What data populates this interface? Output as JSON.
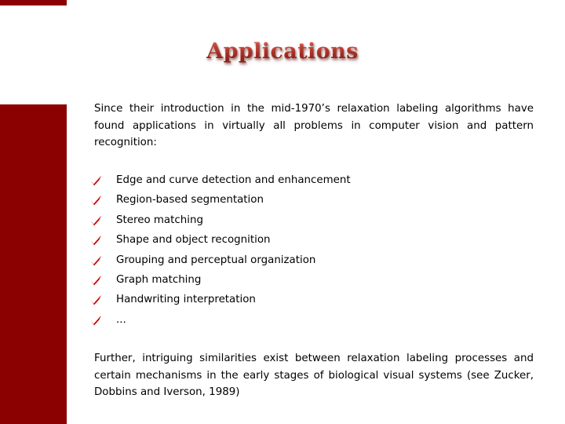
{
  "slide": {
    "title": "Applications",
    "intro_paragraph": "Since their introduction in the mid-1970’s relaxation labeling algorithms have found applications in virtually all problems in computer vision and pattern recognition:",
    "bullets": [
      {
        "icon": "red-check-icon",
        "label": "Edge and curve detection and enhancement"
      },
      {
        "icon": "red-check-icon",
        "label": "Region-based segmentation"
      },
      {
        "icon": "red-check-icon",
        "label": "Stereo matching"
      },
      {
        "icon": "red-check-icon",
        "label": "Shape and object recognition"
      },
      {
        "icon": "red-check-icon",
        "label": "Grouping and perceptual organization"
      },
      {
        "icon": "red-check-icon",
        "label": "Graph matching"
      },
      {
        "icon": "red-check-icon",
        "label": "Handwriting interpretation"
      },
      {
        "icon": "red-check-icon",
        "label": "..."
      }
    ],
    "outro_paragraph": "Further, intriguing similarities exist between relaxation labeling processes and certain mechanisms in the early stages of biological visual systems (see Zucker, Dobbins and Iverson, 1989)",
    "colors": {
      "accent_bar": "#8b0000",
      "title_red": "#c0392b",
      "check_red": "#cc0000",
      "background": "#ffffff",
      "text": "#000000"
    }
  }
}
